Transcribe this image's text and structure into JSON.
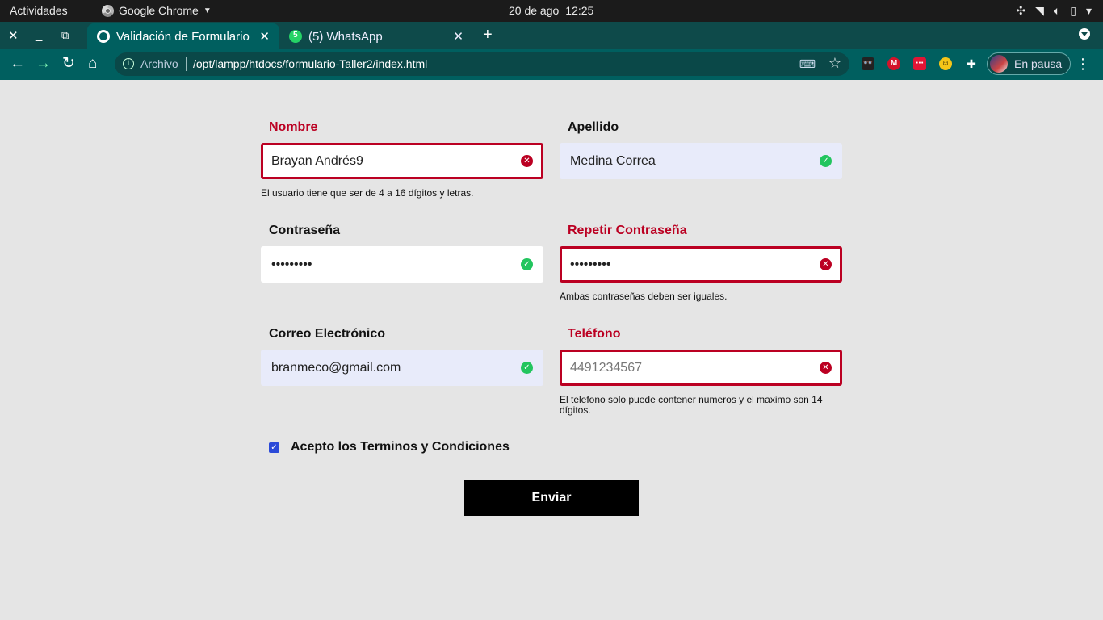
{
  "system_bar": {
    "activities": "Actividades",
    "app_name": "Google Chrome",
    "date": "20 de ago",
    "time": "12:25"
  },
  "browser": {
    "tabs": [
      {
        "title": "Validación de Formulario",
        "active": true
      },
      {
        "title": "(5) WhatsApp",
        "active": false
      }
    ],
    "address": {
      "security_label": "Archivo",
      "url": "/opt/lampp/htdocs/formulario-Taller2/index.html"
    },
    "profile_label": "En pausa"
  },
  "form": {
    "fields": {
      "nombre": {
        "label": "Nombre",
        "value": "Brayan Andrés9",
        "status": "error",
        "error": "El usuario tiene que ser de 4 a 16 dígitos y letras."
      },
      "apellido": {
        "label": "Apellido",
        "value": "Medina Correa",
        "status": "valid"
      },
      "password": {
        "label": "Contraseña",
        "value": "•••••••••",
        "status": "valid"
      },
      "password2": {
        "label": "Repetir Contraseña",
        "value": "•••••••••",
        "status": "error",
        "error": "Ambas contraseñas deben ser iguales."
      },
      "correo": {
        "label": "Correo Electrónico",
        "value": "branmeco@gmail.com",
        "status": "valid"
      },
      "telefono": {
        "label": "Teléfono",
        "value": "",
        "placeholder": "4491234567",
        "status": "error",
        "error": "El telefono solo puede contener numeros y el maximo son 14 dígitos."
      }
    },
    "terms_label": "Acepto los Terminos y Condiciones",
    "terms_checked": true,
    "submit_label": "Enviar"
  },
  "colors": {
    "error": "#bb0022",
    "valid": "#22c55e",
    "checkbox": "#2b4ad8"
  }
}
